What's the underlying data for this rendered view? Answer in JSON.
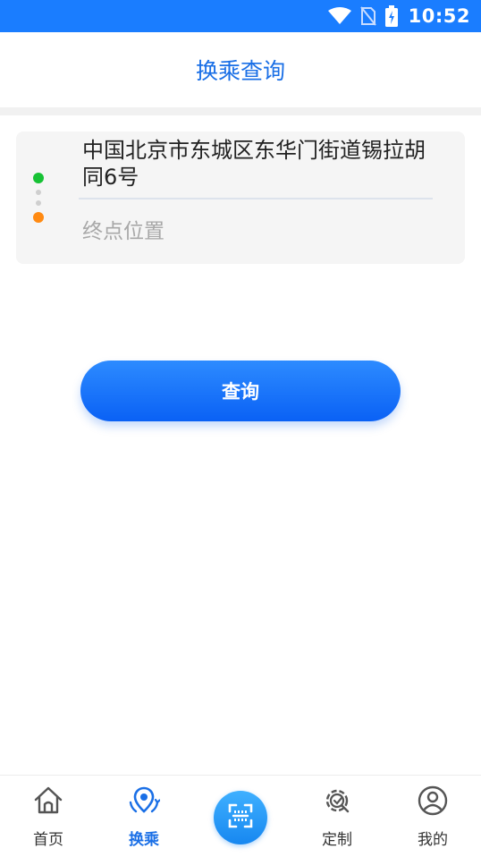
{
  "status_bar": {
    "time": "10:52"
  },
  "header": {
    "title": "换乘查询"
  },
  "route": {
    "origin": "中国北京市东城区东华门街道锡拉胡同6号",
    "destination_placeholder": "终点位置",
    "destination_value": ""
  },
  "query_button": {
    "label": "查询"
  },
  "tab_bar": {
    "active": "换乘",
    "tabs": [
      {
        "label": "首页",
        "icon": "home-icon"
      },
      {
        "label": "换乘",
        "icon": "transfer-location-icon"
      },
      {
        "label": "",
        "icon": "scan-code-icon"
      },
      {
        "label": "定制",
        "icon": "custom-gear-icon"
      },
      {
        "label": "我的",
        "icon": "profile-icon"
      }
    ]
  },
  "colors": {
    "accent": "#1a6fe6",
    "status_bar": "#1a7dff",
    "start_dot": "#17c235",
    "end_dot": "#ff8a12"
  }
}
